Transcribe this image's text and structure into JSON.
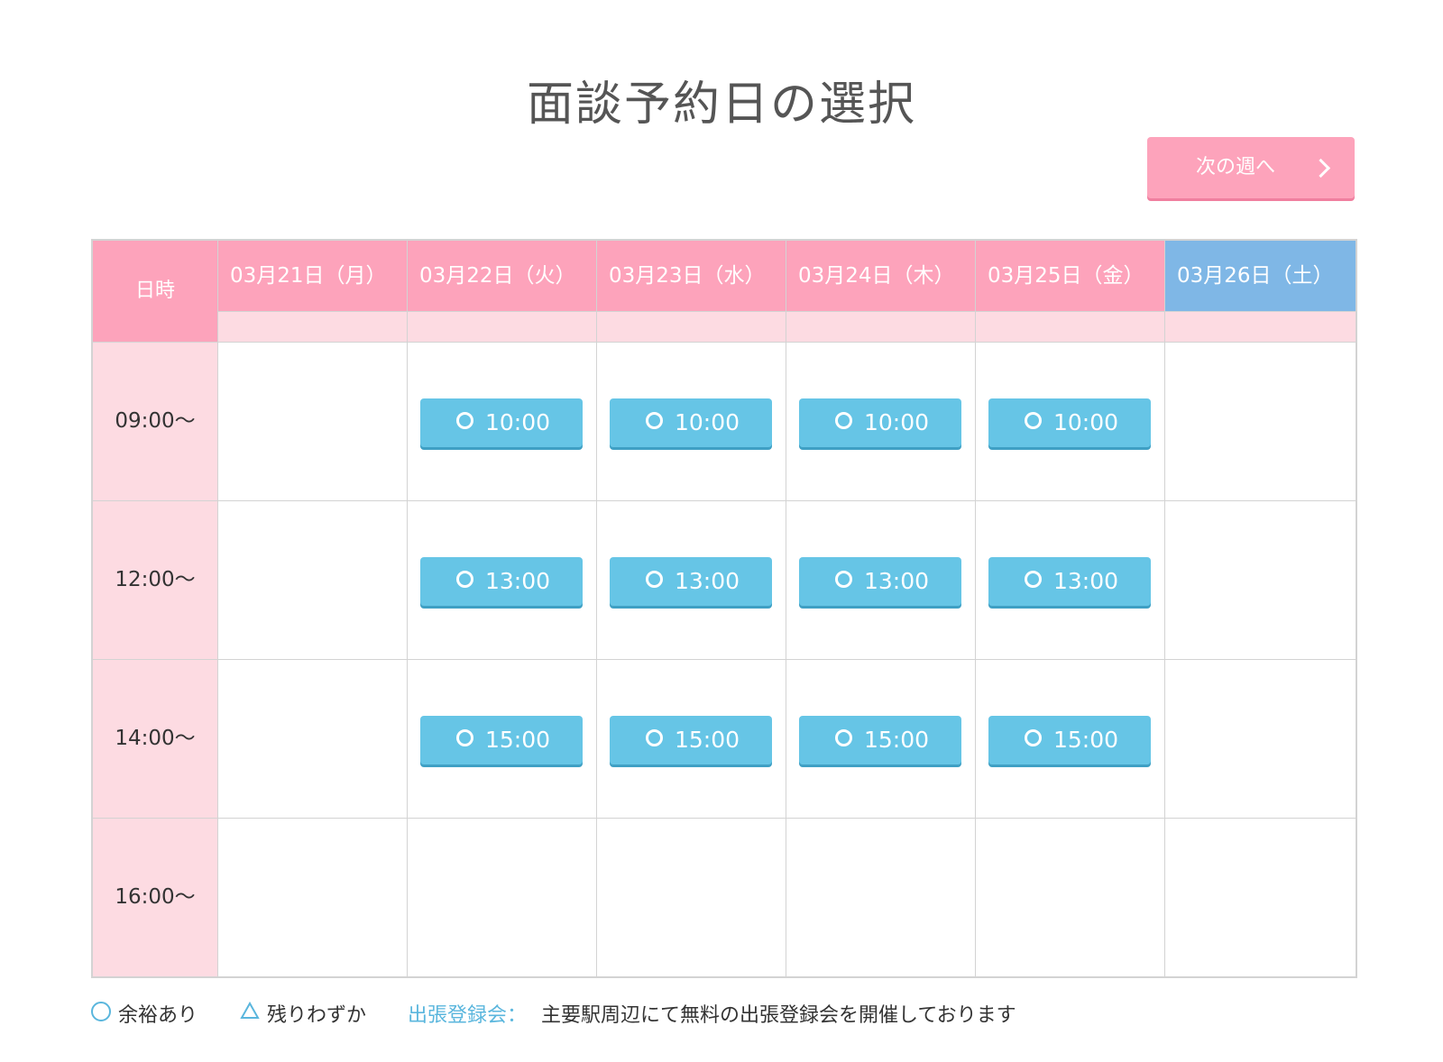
{
  "page": {
    "title": "面談予約日の選択"
  },
  "nav": {
    "next_week_label": "次の週へ"
  },
  "colors": {
    "pink": "#fda3bb",
    "light_pink": "#fddbe2",
    "saturday_blue": "#7fb7e6",
    "slot_blue": "#66c5e6"
  },
  "table": {
    "corner_label": "日時",
    "days": [
      {
        "label": "03月21日（月）",
        "weekday": "mon"
      },
      {
        "label": "03月22日（火）",
        "weekday": "tue"
      },
      {
        "label": "03月23日（水）",
        "weekday": "wed"
      },
      {
        "label": "03月24日（木）",
        "weekday": "thu"
      },
      {
        "label": "03月25日（金）",
        "weekday": "fri"
      },
      {
        "label": "03月26日（土）",
        "weekday": "sat"
      }
    ],
    "rows": [
      {
        "time": "09:00〜",
        "slots": [
          "",
          "10:00",
          "10:00",
          "10:00",
          "10:00",
          ""
        ]
      },
      {
        "time": "12:00〜",
        "slots": [
          "",
          "13:00",
          "13:00",
          "13:00",
          "13:00",
          ""
        ]
      },
      {
        "time": "14:00〜",
        "slots": [
          "",
          "15:00",
          "15:00",
          "15:00",
          "15:00",
          ""
        ]
      },
      {
        "time": "16:00〜",
        "slots": [
          "",
          "",
          "",
          "",
          "",
          ""
        ]
      }
    ]
  },
  "legend": {
    "available": "余裕あり",
    "few_left": "残りわずか",
    "event_label": "出張登録会：",
    "event_text": "主要駅周辺にて無料の出張登録会を開催しております"
  }
}
